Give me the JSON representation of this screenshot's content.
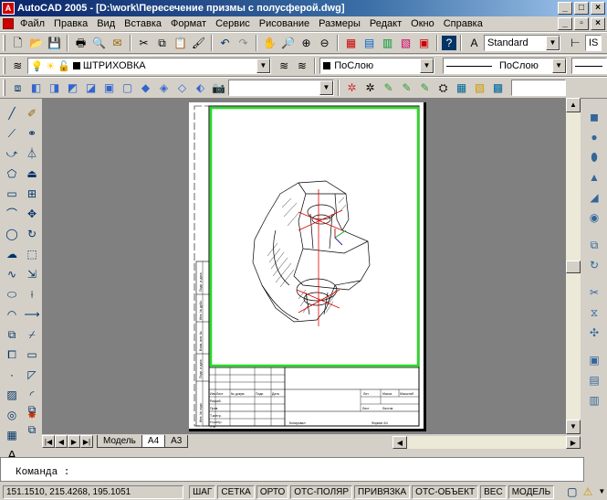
{
  "window": {
    "title": "AutoCAD 2005 - [D:\\work\\Пересечение призмы с полусферой.dwg]",
    "app_icon": "autocad-icon"
  },
  "menu": [
    "Файл",
    "Правка",
    "Вид",
    "Вставка",
    "Формат",
    "Сервис",
    "Рисование",
    "Размеры",
    "Редакт",
    "Окно",
    "Справка"
  ],
  "toolbar1": {
    "textstyle": "Standard",
    "dimstyle_partial": "IS"
  },
  "toolbar2": {
    "layer": "ШТРИХОВКА",
    "color": "ПоСлою",
    "linetype": "ПоСлою"
  },
  "tabs": [
    "Модель",
    "A4",
    "A3"
  ],
  "active_tab": "A4",
  "command": {
    "prompt": "Команда :"
  },
  "status": {
    "coords": "151.1510, 215.4268, 195.1051",
    "modes": [
      "ШАГ",
      "СЕТКА",
      "ОРТО",
      "ОТС-ПОЛЯР",
      "ПРИВЯЗКА",
      "ОТС-ОБЪЕКТ",
      "ВЕС",
      "МОДЕЛЬ"
    ]
  },
  "titleblock": {
    "cells": [
      "Изм",
      "Лист",
      "№ докум.",
      "Подп.",
      "Дата",
      "Разраб.",
      "Пров.",
      "Т.контр.",
      "Н.контр.",
      "Утв.",
      "Лит.",
      "Масса",
      "Масштаб",
      "Лист",
      "Листов"
    ],
    "side": [
      "Инв. № подл.",
      "Подп. и дата",
      "Взам. инв. №",
      "Инв. № дубл.",
      "Подп. и дата"
    ],
    "footer_left": "Копировал",
    "footer_right": "Формат А4"
  },
  "colors": {
    "viewport_border": "#22dd22",
    "cut_line": "#e00000",
    "accent": "#0a246a"
  }
}
